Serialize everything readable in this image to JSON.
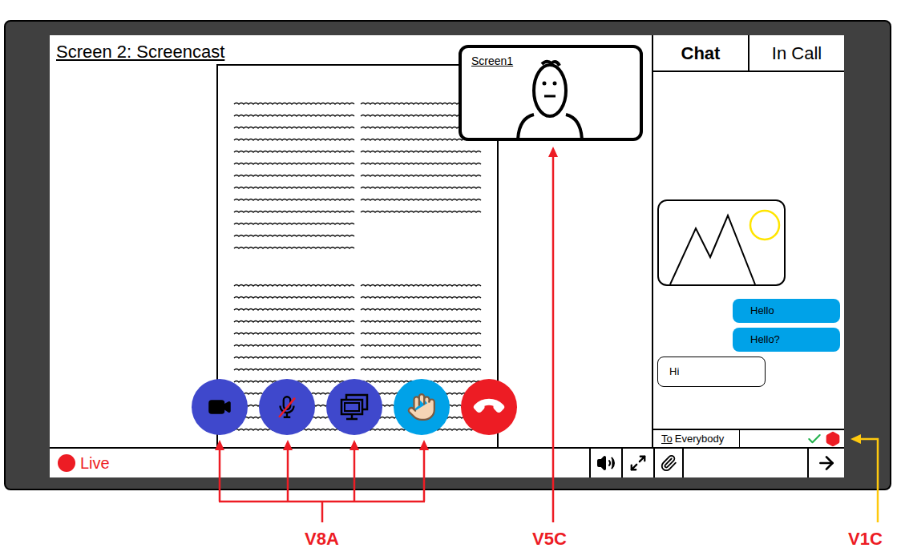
{
  "screen": {
    "title": "Screen 2: Screencast"
  },
  "video_tile": {
    "label": "Screen1"
  },
  "controls": [
    {
      "kind": "camera",
      "off": false,
      "color": "#3f48cc"
    },
    {
      "kind": "microphone",
      "off": true,
      "color": "#3f48cc"
    },
    {
      "kind": "share",
      "off": false,
      "color": "#3f48cc"
    },
    {
      "kind": "hand",
      "off": false,
      "color": "#00a2e8"
    },
    {
      "kind": "hangup",
      "off": false,
      "color": "#ed1c24"
    }
  ],
  "chat": {
    "tabs": [
      {
        "label": "Chat",
        "selected": true
      },
      {
        "label": "In Call",
        "selected": false
      }
    ],
    "messages": [
      {
        "kind": "image",
        "mine": false,
        "text": ""
      },
      {
        "kind": "text",
        "mine": true,
        "text": "Hello"
      },
      {
        "kind": "text",
        "mine": true,
        "text": "Hello?"
      },
      {
        "kind": "text",
        "mine": false,
        "text": "Hi"
      }
    ],
    "to_label": "To",
    "recipient": "Everybody"
  },
  "status_bar": {
    "live": "Live"
  },
  "annotations": [
    {
      "label": "V8A",
      "color": "#ed1c24"
    },
    {
      "label": "V5C",
      "color": "#ed1c24"
    },
    {
      "label": "V1C",
      "color": "#ffc90e"
    }
  ]
}
